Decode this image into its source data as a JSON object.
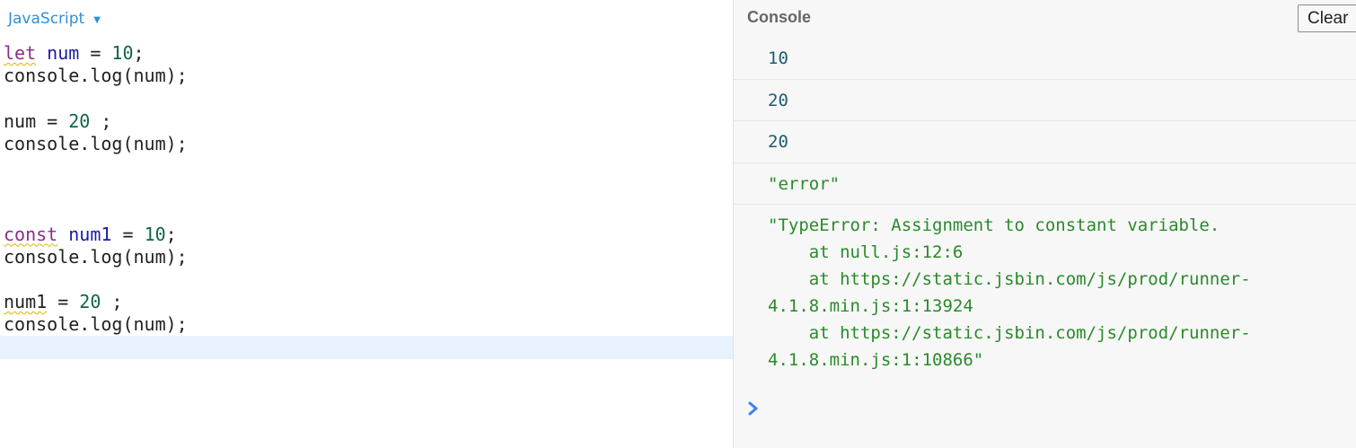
{
  "editor": {
    "language": "JavaScript",
    "lines": {
      "l1": {
        "keyword": "let",
        "name": "num",
        "op": " = ",
        "value": "10",
        "end": ";"
      },
      "l2": "console.log(num);",
      "l4": {
        "name": "num",
        "op": " = ",
        "value": "20",
        "end": " ;"
      },
      "l5": "console.log(num);",
      "l9": {
        "keyword": "const",
        "name": "num1",
        "op": " = ",
        "value": "10",
        "end": ";"
      },
      "l10": "console.log(num);",
      "l12": {
        "name": "num1",
        "op": " = ",
        "value": "20",
        "end": " ;"
      },
      "l13": "console.log(num);"
    }
  },
  "console": {
    "title": "Console",
    "clear_label": "Clear",
    "entries": [
      "10",
      "20",
      "20",
      "\"error\"",
      "\"TypeError: Assignment to constant variable.\n    at null.js:12:6\n    at https://static.jsbin.com/js/prod/runner-4.1.8.min.js:1:13924\n    at https://static.jsbin.com/js/prod/runner-4.1.8.min.js:1:10866\""
    ]
  },
  "colors": {
    "keyword": "#8a2f8a",
    "variable": "#1a1aa6",
    "number": "#116644",
    "console_number": "#1c5d6e",
    "console_string": "#2a8a2a",
    "prompt": "#3b82f6",
    "active_line": "#e8f2ff"
  },
  "icons": {
    "language_caret": "caret-down-icon",
    "console_prompt": "chevron-right-icon"
  }
}
